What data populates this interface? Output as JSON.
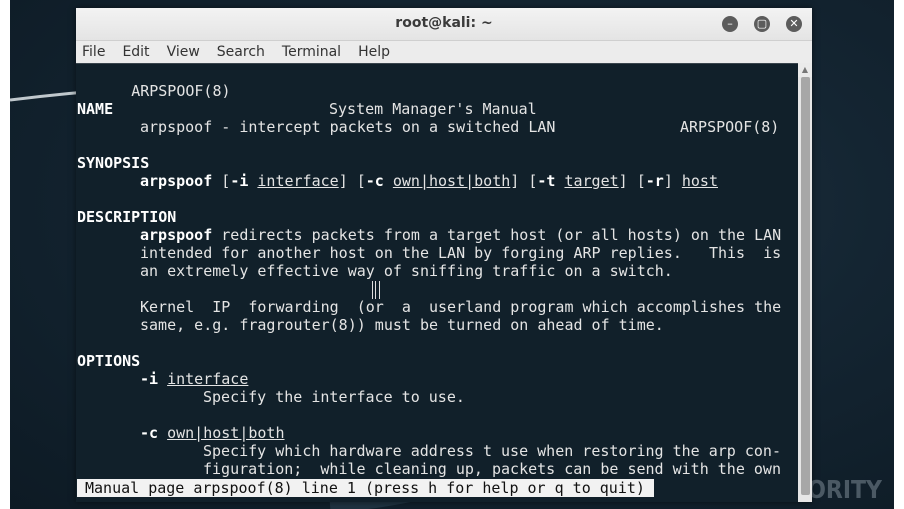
{
  "window": {
    "title": "root@kali: ~"
  },
  "menubar": {
    "items": [
      "File",
      "Edit",
      "View",
      "Search",
      "Terminal",
      "Help"
    ]
  },
  "man": {
    "header_left": "ARPSPOOF(8)",
    "header_center": "System Manager's Manual",
    "header_right": "ARPSPOOF(8)",
    "name_heading": "NAME",
    "name_text": "arpspoof - intercept packets on a switched LAN",
    "synopsis_heading": "SYNOPSIS",
    "synopsis": {
      "cmd": "arpspoof",
      "p1": " [",
      "opt_i": "-i",
      "sp1": " ",
      "arg_interface": "interface",
      "p2": "] [",
      "opt_c": "-c",
      "sp2": " ",
      "arg_own": "own|host|both",
      "p3": "] [",
      "opt_t": "-t",
      "sp3": " ",
      "arg_target": "target",
      "p4": "] [",
      "opt_r": "-r",
      "p5": "] ",
      "arg_host": "host"
    },
    "description_heading": "DESCRIPTION",
    "desc_cmd": "arpspoof",
    "desc_line1_rest": " redirects packets from a target host (or all hosts) on the LAN",
    "desc_line2": "intended for another host on the LAN by forging ARP replies.   This  is",
    "desc_line3": "an extremely effective way of sniffing traffic on a switch.",
    "desc_line4": "Kernel  IP  forwarding  (or  a  userland program which accomplishes the",
    "desc_line5": "same, e.g. fragrouter(8)) must be turned on ahead of time.",
    "options_heading": "OPTIONS",
    "opt_i_flag": "-i",
    "opt_i_arg": "interface",
    "opt_i_desc": "Specify the interface to use.",
    "opt_c_flag": "-c",
    "opt_c_arg": "own|host|both",
    "opt_c_desc1": "Specify which hardware address t use when restoring the arp con-",
    "opt_c_desc2": "figuration;  while cleaning up, packets can be send with the own"
  },
  "status": {
    "text": "Manual page arpspoof(8) line 1 (press h for help or q to quit)"
  },
  "watermark": {
    "text": "ANDROID AUTHORITY"
  }
}
